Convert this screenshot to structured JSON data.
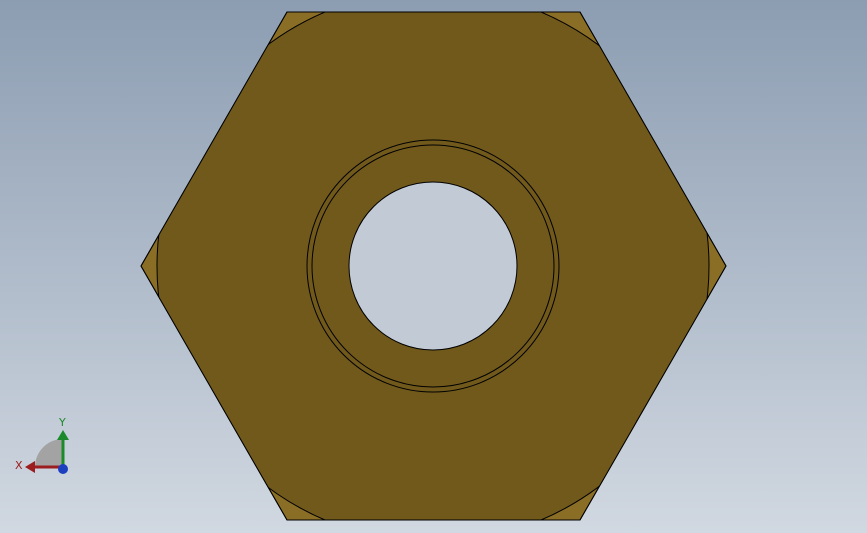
{
  "colors": {
    "background_top": "#8c9db2",
    "background_bottom": "#d1d8e1",
    "part_face": "#71591c",
    "part_chamfer": "#8a6e26",
    "edge": "#000000",
    "hole": "#c2cad6",
    "axis_x": "#9b1d1d",
    "axis_y": "#1c8a2a",
    "axis_z": "#1c3fbf",
    "triad_quadrant": "#a3a3a3"
  },
  "triad": {
    "x_label": "X",
    "y_label": "Y"
  }
}
